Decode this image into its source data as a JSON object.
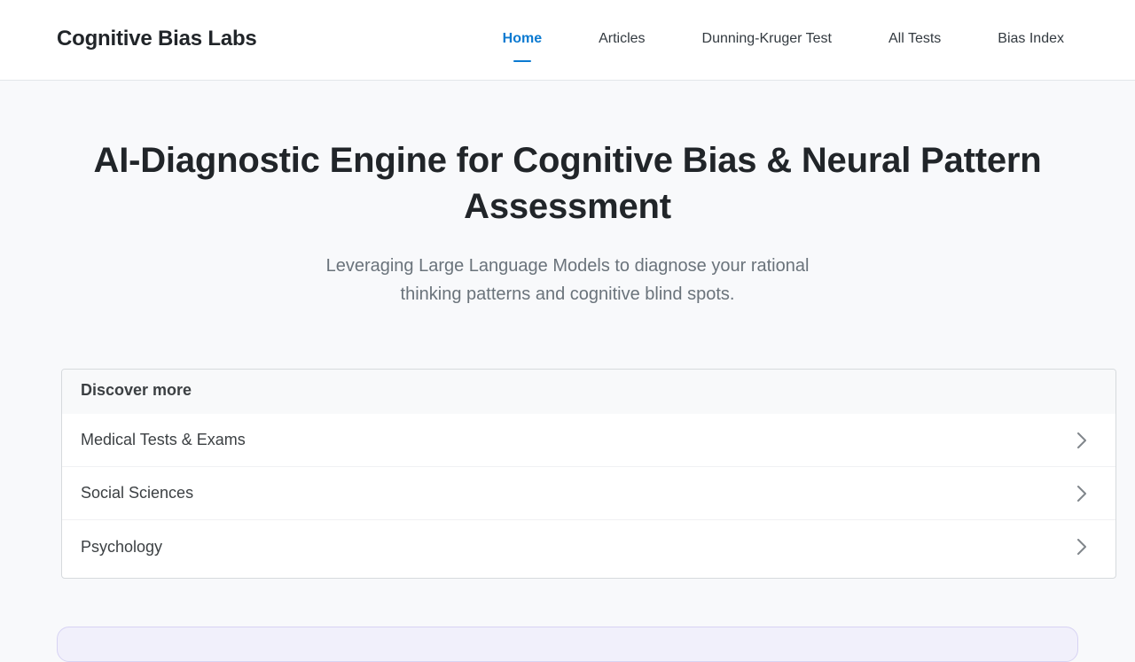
{
  "header": {
    "brand": "Cognitive Bias Labs",
    "nav": [
      {
        "label": "Home",
        "active": true
      },
      {
        "label": "Articles",
        "active": false
      },
      {
        "label": "Dunning-Kruger Test",
        "active": false
      },
      {
        "label": "All Tests",
        "active": false
      },
      {
        "label": "Bias Index",
        "active": false
      }
    ]
  },
  "hero": {
    "title": "AI-Diagnostic Engine for Cognitive Bias & Neural Pattern Assessment",
    "subtitle": "Leveraging Large Language Models to diagnose your rational thinking patterns and cognitive blind spots."
  },
  "discover": {
    "heading": "Discover more",
    "items": [
      {
        "label": "Medical Tests & Exams",
        "icon": "chevron-right-icon"
      },
      {
        "label": "Social Sciences",
        "icon": "chevron-right-icon"
      },
      {
        "label": "Psychology",
        "icon": "chevron-right-icon"
      }
    ]
  },
  "colors": {
    "accent": "#0b7ad1",
    "background": "#f8f9fb",
    "bottom_card": "#f1f0fb"
  }
}
